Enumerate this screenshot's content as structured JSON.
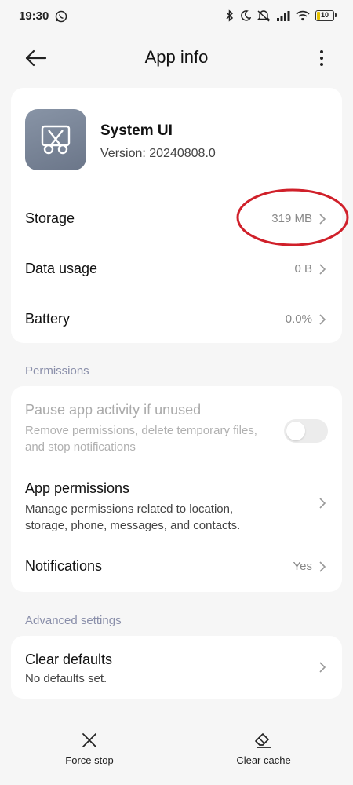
{
  "status_bar": {
    "time": "19:30",
    "battery": "10",
    "icons": [
      "whatsapp-icon",
      "bluetooth-icon",
      "moon-icon",
      "mute-icon",
      "signal-icon",
      "wifi-icon",
      "battery-icon"
    ]
  },
  "header": {
    "title": "App info",
    "back_icon": "arrow-left-icon",
    "more_icon": "more-vertical-icon"
  },
  "app": {
    "name": "System UI",
    "version": "Version: 20240808.0",
    "icon": "scissors-icon"
  },
  "info_rows": [
    {
      "label": "Storage",
      "value": "319 MB"
    },
    {
      "label": "Data usage",
      "value": "0 B"
    },
    {
      "label": "Battery",
      "value": "0.0%"
    }
  ],
  "permissions": {
    "section_label": "Permissions",
    "pause": {
      "label": "Pause app activity if unused",
      "sub": "Remove permissions, delete temporary files, and stop notifications",
      "enabled": false
    },
    "app_permissions": {
      "label": "App permissions",
      "sub": "Manage permissions related to location, storage, phone, messages, and contacts."
    },
    "notifications": {
      "label": "Notifications",
      "value": "Yes"
    }
  },
  "advanced": {
    "section_label": "Advanced settings",
    "clear_defaults": {
      "label": "Clear defaults",
      "sub": "No defaults set."
    }
  },
  "bottom_actions": {
    "force_stop": "Force stop",
    "clear_cache": "Clear cache"
  },
  "colors": {
    "annotation": "#d0202a",
    "section_label": "#8a8faa",
    "app_icon_bg": "#7a8598"
  }
}
